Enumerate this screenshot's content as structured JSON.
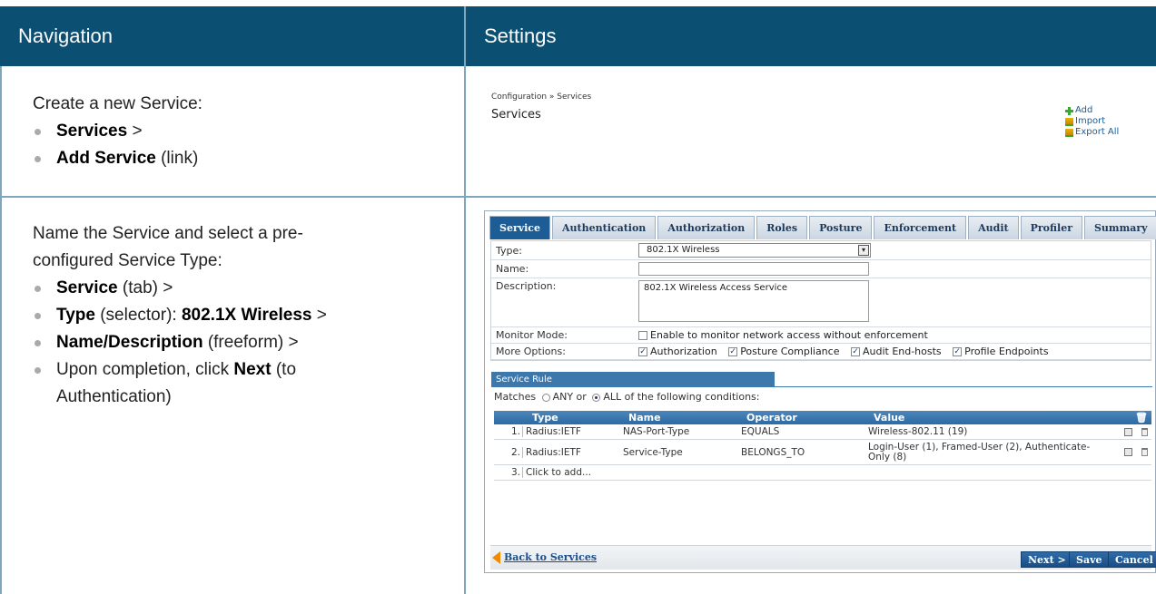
{
  "headers": {
    "navigation": "Navigation",
    "settings": "Settings"
  },
  "nav1": {
    "intro": "Create a new Service:",
    "items": [
      {
        "bold": "Services",
        "rest": " >"
      },
      {
        "bold": "Add Service",
        "rest": " (link)"
      }
    ]
  },
  "nav2": {
    "intro_line1": "Name the Service and select a pre-",
    "intro_line2": "configured Service Type:",
    "items": [
      {
        "bold": "Service",
        "rest": " (tab) >"
      },
      {
        "bold": "Type",
        "rest": " (selector): ",
        "bold2": "802.1X Wireless",
        "rest2": " >"
      },
      {
        "bold": "Name/Description",
        "rest": " (freeform) >"
      },
      {
        "pre": "Upon completion, click ",
        "bold": "Next",
        "rest": " (to",
        "line2": "Authentication)"
      }
    ]
  },
  "services_page": {
    "breadcrumb": "Configuration » Services",
    "title": "Services",
    "actions": [
      "Add",
      "Import",
      "Export All"
    ]
  },
  "service_editor": {
    "tabs": [
      "Service",
      "Authentication",
      "Authorization",
      "Roles",
      "Posture",
      "Enforcement",
      "Audit",
      "Profiler",
      "Summary"
    ],
    "active_tab": "Service",
    "form": {
      "type_label": "Type:",
      "type_value": "802.1X Wireless",
      "name_label": "Name:",
      "name_value": "",
      "description_label": "Description:",
      "description_value": "802.1X Wireless Access Service",
      "monitor_label": "Monitor Mode:",
      "monitor_text": "Enable to monitor network access without enforcement",
      "more_label": "More Options:",
      "more_options": [
        "Authorization",
        "Posture Compliance",
        "Audit End-hosts",
        "Profile Endpoints"
      ]
    },
    "service_rule": {
      "title": "Service Rule",
      "matches_prefix": "Matches",
      "match_any": "ANY",
      "match_or": "or",
      "match_all": "ALL of the following conditions:",
      "columns": [
        "Type",
        "Name",
        "Operator",
        "Value"
      ],
      "rows": [
        {
          "num": "1.",
          "type": "Radius:IETF",
          "name": "NAS-Port-Type",
          "operator": "EQUALS",
          "value": "Wireless-802.11 (19)"
        },
        {
          "num": "2.",
          "type": "Radius:IETF",
          "name": "Service-Type",
          "operator": "BELONGS_TO",
          "value": "Login-User (1), Framed-User (2), Authenticate-Only (8)"
        },
        {
          "num": "3.",
          "type": "Click to add...",
          "name": "",
          "operator": "",
          "value": ""
        }
      ]
    },
    "bottom": {
      "back": "Back to Services",
      "next": "Next >",
      "save": "Save",
      "cancel": "Cancel"
    }
  }
}
